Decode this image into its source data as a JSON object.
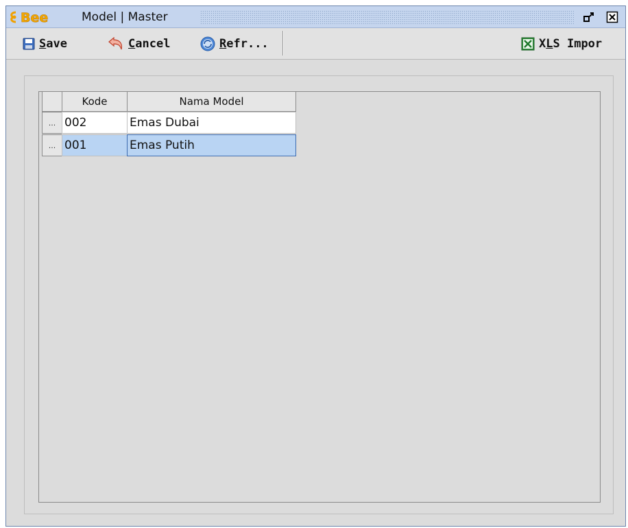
{
  "window": {
    "logo_text": "Bee",
    "title": "Model | Master"
  },
  "toolbar": {
    "save": {
      "label_key": "S",
      "label_rest": "ave"
    },
    "cancel": {
      "label_key": "C",
      "label_rest": "ancel"
    },
    "refresh": {
      "label_key": "R",
      "label_rest": "efr..."
    },
    "xls": {
      "label_a": "X",
      "label_key": "L",
      "label_b": "S Impor"
    }
  },
  "grid": {
    "columns": [
      "Kode",
      "Nama Model"
    ],
    "rows": [
      {
        "marker": "...",
        "kode": "002",
        "nama": "Emas Dubai"
      },
      {
        "marker": "...",
        "kode": "001",
        "nama": "Emas Putih"
      }
    ]
  },
  "colors": {
    "titlebar": "#c5d5ee",
    "selection": "#b9d4f3",
    "logo": "#f0a000"
  }
}
